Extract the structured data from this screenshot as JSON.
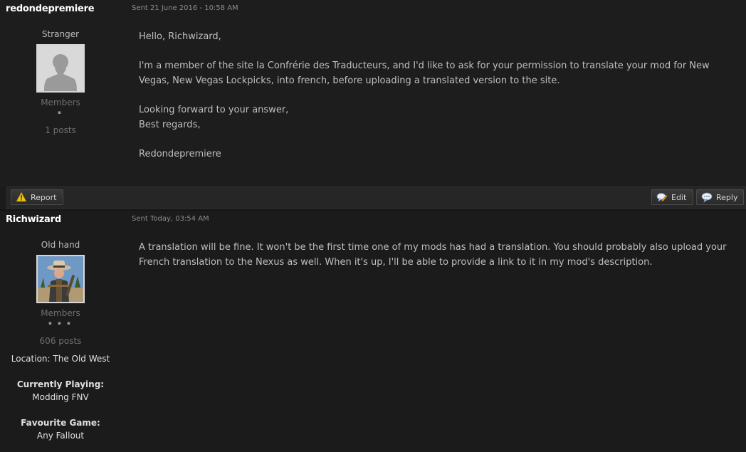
{
  "posts": [
    {
      "author": "redondepremiere",
      "date": "Sent 21 June 2016 - 10:58 AM",
      "rank": "Stranger",
      "group": "Members",
      "pips": "▪",
      "post_count": "1 posts",
      "body": [
        "Hello, Richwizard,",
        "I'm a member of the site la Confrérie des Traducteurs, and I'd like to ask for your permission to translate your mod for New Vegas, New Vegas Lockpicks, into french, before uploading a translated version to the site.",
        "Looking forward to your answer,",
        "Best regards,",
        "Redondepremiere"
      ]
    },
    {
      "author": "Richwizard",
      "date": "Sent Today, 03:54 AM",
      "rank": "Old hand",
      "group": "Members",
      "pips": "▪ ▪ ▪",
      "post_count": "606 posts",
      "location": "Location: The Old West",
      "playing_label": "Currently Playing:",
      "playing_value": "Modding FNV",
      "fav_label": "Favourite Game:",
      "fav_value": "Any Fallout",
      "body": [
        "A translation will be fine. It won't be the first time one of my mods has had a translation. You should probably also upload your French translation to the Nexus as well. When it's up, I'll be able to provide a link to it in my mod's description."
      ]
    }
  ],
  "toolbar": {
    "report_label": "Report",
    "edit_label": "Edit",
    "reply_label": "Reply"
  },
  "icons": {
    "report": "warning-icon",
    "edit": "edit-speech-icon",
    "reply": "reply-speech-icon"
  }
}
